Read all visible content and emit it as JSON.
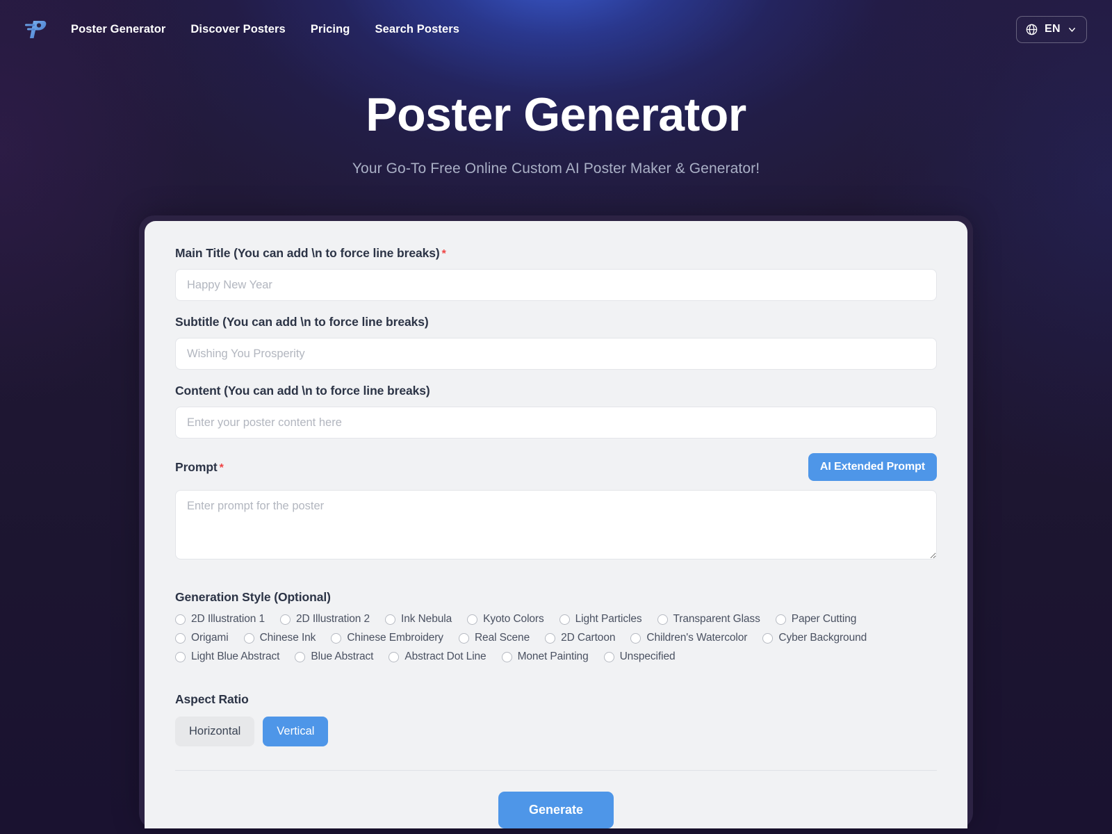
{
  "nav": {
    "logo_icon": "poster-p-logo-icon",
    "links": [
      {
        "label": "Poster Generator"
      },
      {
        "label": "Discover Posters"
      },
      {
        "label": "Pricing"
      },
      {
        "label": "Search Posters"
      }
    ],
    "language": {
      "icon": "globe-icon",
      "code": "EN",
      "chevron_icon": "chevron-down-icon"
    }
  },
  "hero": {
    "title": "Poster Generator",
    "subtitle": "Your Go-To Free Online Custom AI Poster Maker & Generator!"
  },
  "form": {
    "main_title": {
      "label": "Main Title (You can add \\n to force line breaks)",
      "required_marker": "*",
      "placeholder": "Happy New Year",
      "value": ""
    },
    "subtitle": {
      "label": "Subtitle (You can add \\n to force line breaks)",
      "placeholder": "Wishing You Prosperity",
      "value": ""
    },
    "content": {
      "label": "Content (You can add \\n to force line breaks)",
      "placeholder": "Enter your poster content here",
      "value": ""
    },
    "prompt": {
      "label": "Prompt",
      "required_marker": "*",
      "placeholder": "Enter prompt for the poster",
      "value": "",
      "ai_button_label": "AI Extended Prompt"
    },
    "generation_style": {
      "label": "Generation Style (Optional)",
      "selected": null,
      "options": [
        {
          "label": "2D Illustration 1",
          "selected": false
        },
        {
          "label": "2D Illustration 2",
          "selected": false
        },
        {
          "label": "Ink Nebula",
          "selected": false
        },
        {
          "label": "Kyoto Colors",
          "selected": false
        },
        {
          "label": "Light Particles",
          "selected": false
        },
        {
          "label": "Transparent Glass",
          "selected": false
        },
        {
          "label": "Paper Cutting",
          "selected": false
        },
        {
          "label": "Origami",
          "selected": false
        },
        {
          "label": "Chinese Ink",
          "selected": false
        },
        {
          "label": "Chinese Embroidery",
          "selected": false
        },
        {
          "label": "Real Scene",
          "selected": false
        },
        {
          "label": "2D Cartoon",
          "selected": false
        },
        {
          "label": "Children's Watercolor",
          "selected": false
        },
        {
          "label": "Cyber Background",
          "selected": false
        },
        {
          "label": "Light Blue Abstract",
          "selected": false
        },
        {
          "label": "Blue Abstract",
          "selected": false
        },
        {
          "label": "Abstract Dot Line",
          "selected": false
        },
        {
          "label": "Monet Painting",
          "selected": false
        },
        {
          "label": "Unspecified",
          "selected": false
        }
      ]
    },
    "aspect_ratio": {
      "label": "Aspect Ratio",
      "options": [
        {
          "label": "Horizontal",
          "selected": false
        },
        {
          "label": "Vertical",
          "selected": true
        }
      ]
    },
    "submit": {
      "label": "Generate"
    }
  },
  "colors": {
    "accent_blue": "#4e96e8",
    "required_red": "#ef4444",
    "card_bg": "#f1f2f4",
    "frame_bg": "#2c2243",
    "page_bg": "#1d1530"
  }
}
